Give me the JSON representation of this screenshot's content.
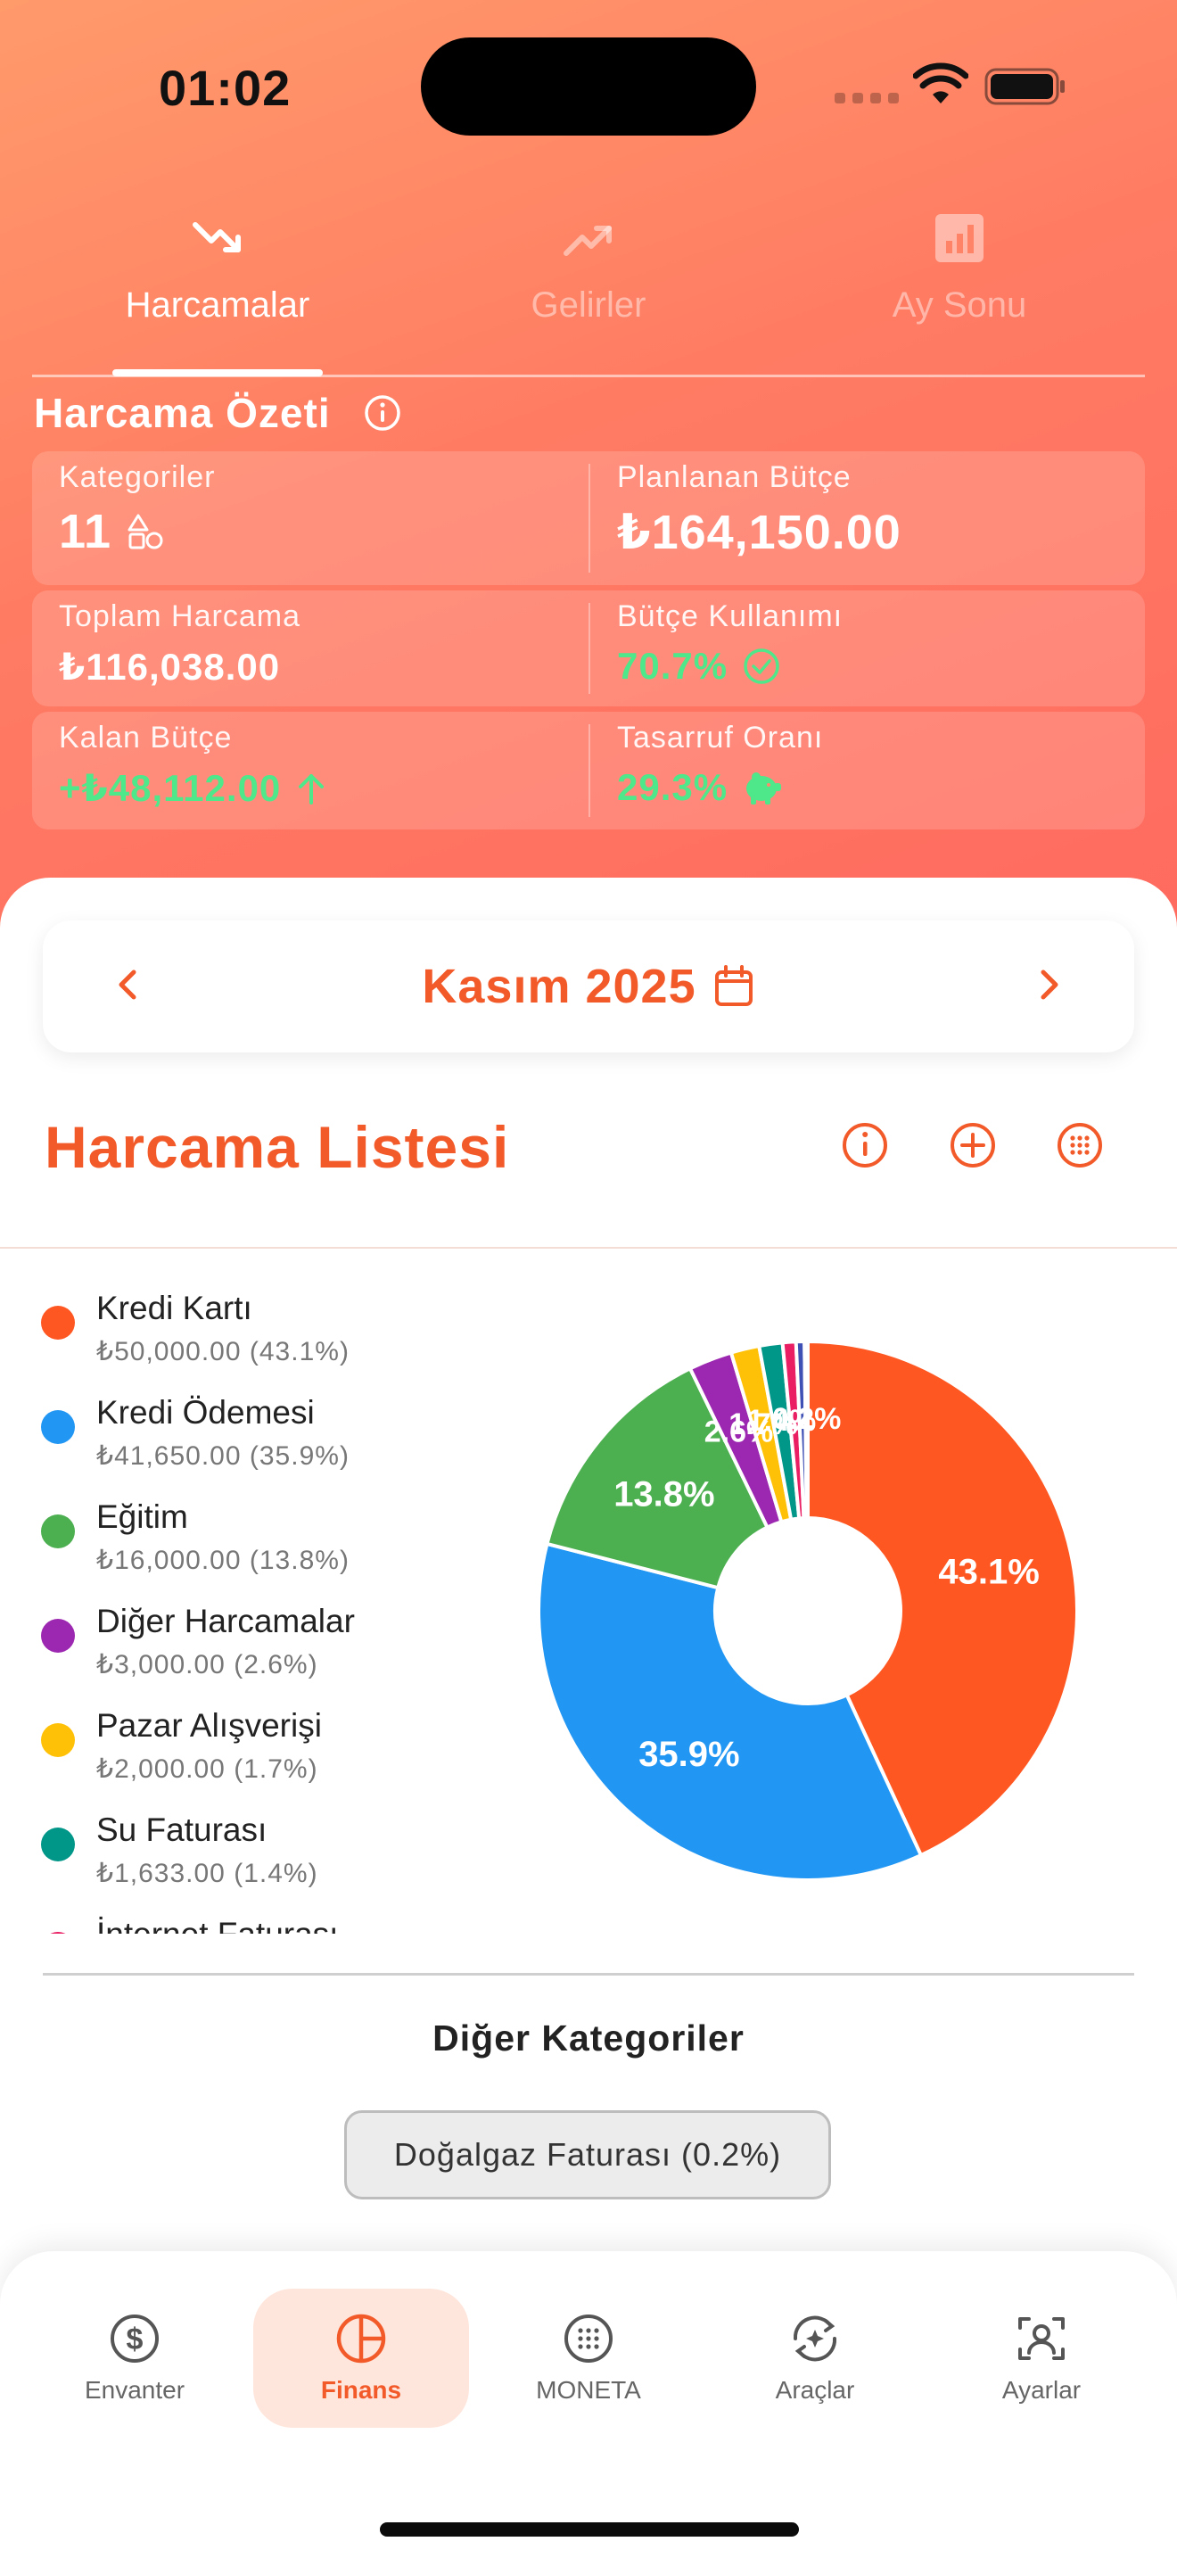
{
  "status_bar": {
    "time": "01:02"
  },
  "tabs": [
    {
      "label": "Harcamalar",
      "icon": "trend-down-icon",
      "active": true
    },
    {
      "label": "Gelirler",
      "icon": "trend-up-icon",
      "active": false
    },
    {
      "label": "Ay Sonu",
      "icon": "bar-chart-icon",
      "active": false
    }
  ],
  "summary": {
    "title": "Harcama Özeti",
    "categories_label": "Kategoriler",
    "categories_value": "11",
    "planned_label": "Planlanan Bütçe",
    "planned_value": "₺164,150.00",
    "total_label": "Toplam Harcama",
    "total_value": "₺116,038.00",
    "usage_label": "Bütçe Kullanımı",
    "usage_value": "70.7%",
    "remaining_label": "Kalan Bütçe",
    "remaining_value": "+₺48,112.00",
    "savings_label": "Tasarruf Oranı",
    "savings_value": "29.3%"
  },
  "month": {
    "label": "Kasım 2025"
  },
  "list": {
    "title": "Harcama Listesi"
  },
  "colors": {
    "accent": "#f25a2a",
    "positive": "#4ee88a"
  },
  "chart_data": {
    "type": "pie",
    "donut": true,
    "legend_position": "left",
    "series": [
      {
        "name": "Kredi Kartı",
        "amount": "₺50,000.00",
        "percent_label": "43.1%",
        "sub": "₺50,000.00 (43.1%)",
        "value": 43.1,
        "color": "#ff5722"
      },
      {
        "name": "Kredi Ödemesi",
        "amount": "₺41,650.00",
        "percent_label": "35.9%",
        "sub": "₺41,650.00 (35.9%)",
        "value": 35.9,
        "color": "#2196f3"
      },
      {
        "name": "Eğitim",
        "amount": "₺16,000.00",
        "percent_label": "13.8%",
        "sub": "₺16,000.00 (13.8%)",
        "value": 13.8,
        "color": "#4caf50"
      },
      {
        "name": "Diğer Harcamalar",
        "amount": "₺3,000.00",
        "percent_label": "2.6%",
        "sub": "₺3,000.00 (2.6%)",
        "value": 2.6,
        "color": "#9c27b0"
      },
      {
        "name": "Pazar Alışverişi",
        "amount": "₺2,000.00",
        "percent_label": "1.7%",
        "sub": "₺2,000.00 (1.7%)",
        "value": 1.7,
        "color": "#ffc107"
      },
      {
        "name": "Su Faturası",
        "amount": "₺1,633.00",
        "percent_label": "1.4%",
        "sub": "₺1,633.00 (1.4%)",
        "value": 1.4,
        "color": "#009688"
      },
      {
        "name": "İnternet Faturası",
        "amount": "",
        "percent_label": "",
        "sub": "",
        "value": 0.8,
        "color": "#e91e63"
      },
      {
        "name": "",
        "amount": "",
        "percent_label": "",
        "sub": "",
        "value": 0.5,
        "color": "#3f51b5"
      },
      {
        "name": "Doğalgaz Faturası",
        "amount": "",
        "percent_label": "0.2%",
        "sub": "",
        "value": 0.2,
        "color": "#795548"
      }
    ]
  },
  "other_categories": {
    "title": "Diğer Kategoriler",
    "chip": "Doğalgaz Faturası (0.2%)"
  },
  "bottom_nav": [
    {
      "label": "Envanter",
      "icon": "dollar-circle-icon",
      "active": false
    },
    {
      "label": "Finans",
      "icon": "pie-chart-icon",
      "active": true
    },
    {
      "label": "MONETA",
      "icon": "grid-dots-icon",
      "active": false
    },
    {
      "label": "Araçlar",
      "icon": "tools-sparkle-icon",
      "active": false
    },
    {
      "label": "Ayarlar",
      "icon": "user-settings-icon",
      "active": false
    }
  ]
}
